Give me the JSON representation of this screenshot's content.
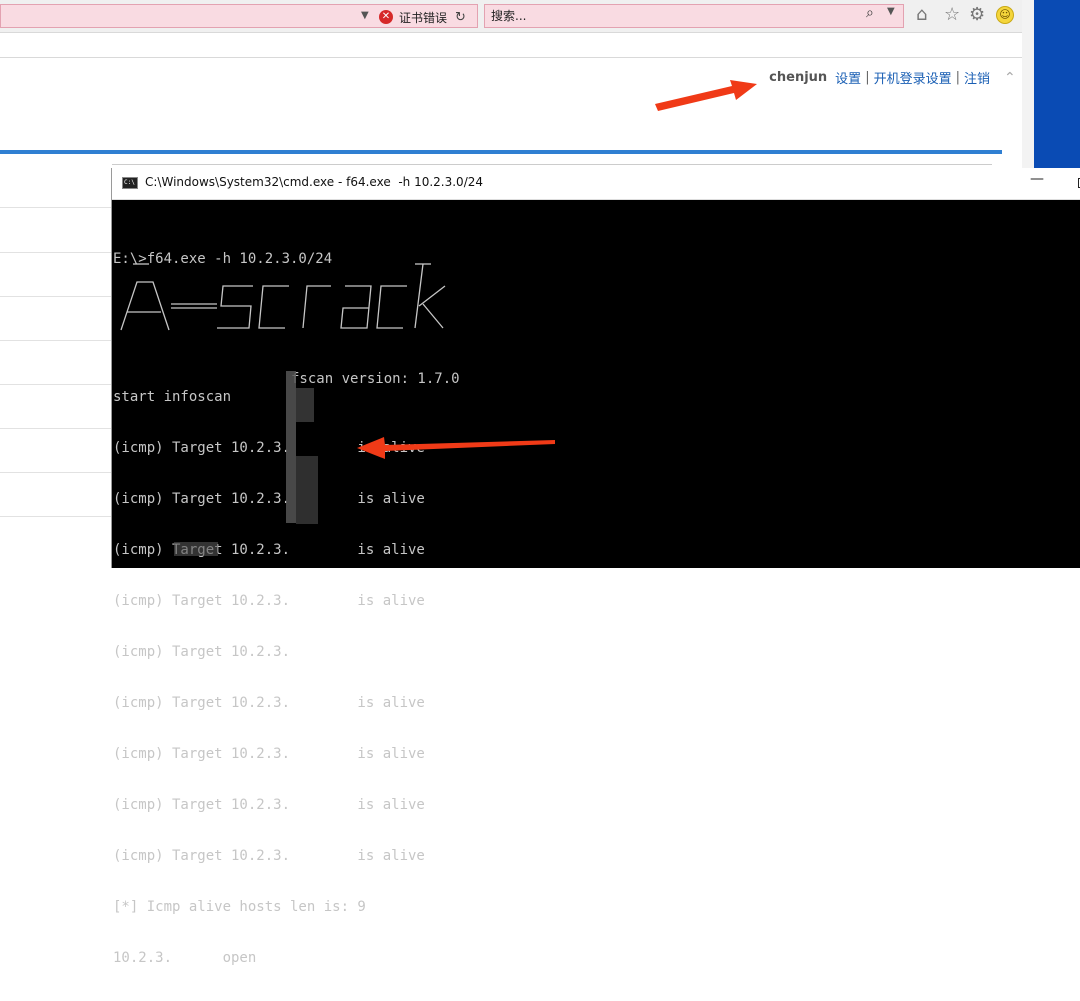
{
  "browser": {
    "cert_error": "证书错误",
    "search_placeholder": "搜索...",
    "user": {
      "name": "chenjun",
      "links": [
        "设置",
        "开机登录设置",
        "注销"
      ]
    }
  },
  "cmd": {
    "title": "C:\\Windows\\System32\\cmd.exe - f64.exe  -h 10.2.3.0/24",
    "command": "E:\\>f64.exe -h 10.2.3.0/24",
    "banner_version": "fscan version: 1.7.0",
    "start_line": "start infoscan",
    "icmp_lines": [
      "(icmp) Target 10.2.3.        is alive",
      "(icmp) Target 10.2.3.        is alive",
      "(icmp) Target 10.2.3.        is alive",
      "(icmp) Target 10.2.3.        is alive",
      "(icmp) Target 10.2.3.",
      "(icmp) Target 10.2.3.        is alive",
      "(icmp) Target 10.2.3.        is alive",
      "(icmp) Target 10.2.3.        is alive",
      "(icmp) Target 10.2.3.        is alive"
    ],
    "summary_line": "[*] Icmp alive hosts len is: 9",
    "open_line": "10.2.3.      open"
  },
  "colors": {
    "ie_pink": "#f9dbe2",
    "link_blue": "#1a5fb4",
    "arrow_red": "#f03a17",
    "console_text": "#c6c6c6"
  }
}
